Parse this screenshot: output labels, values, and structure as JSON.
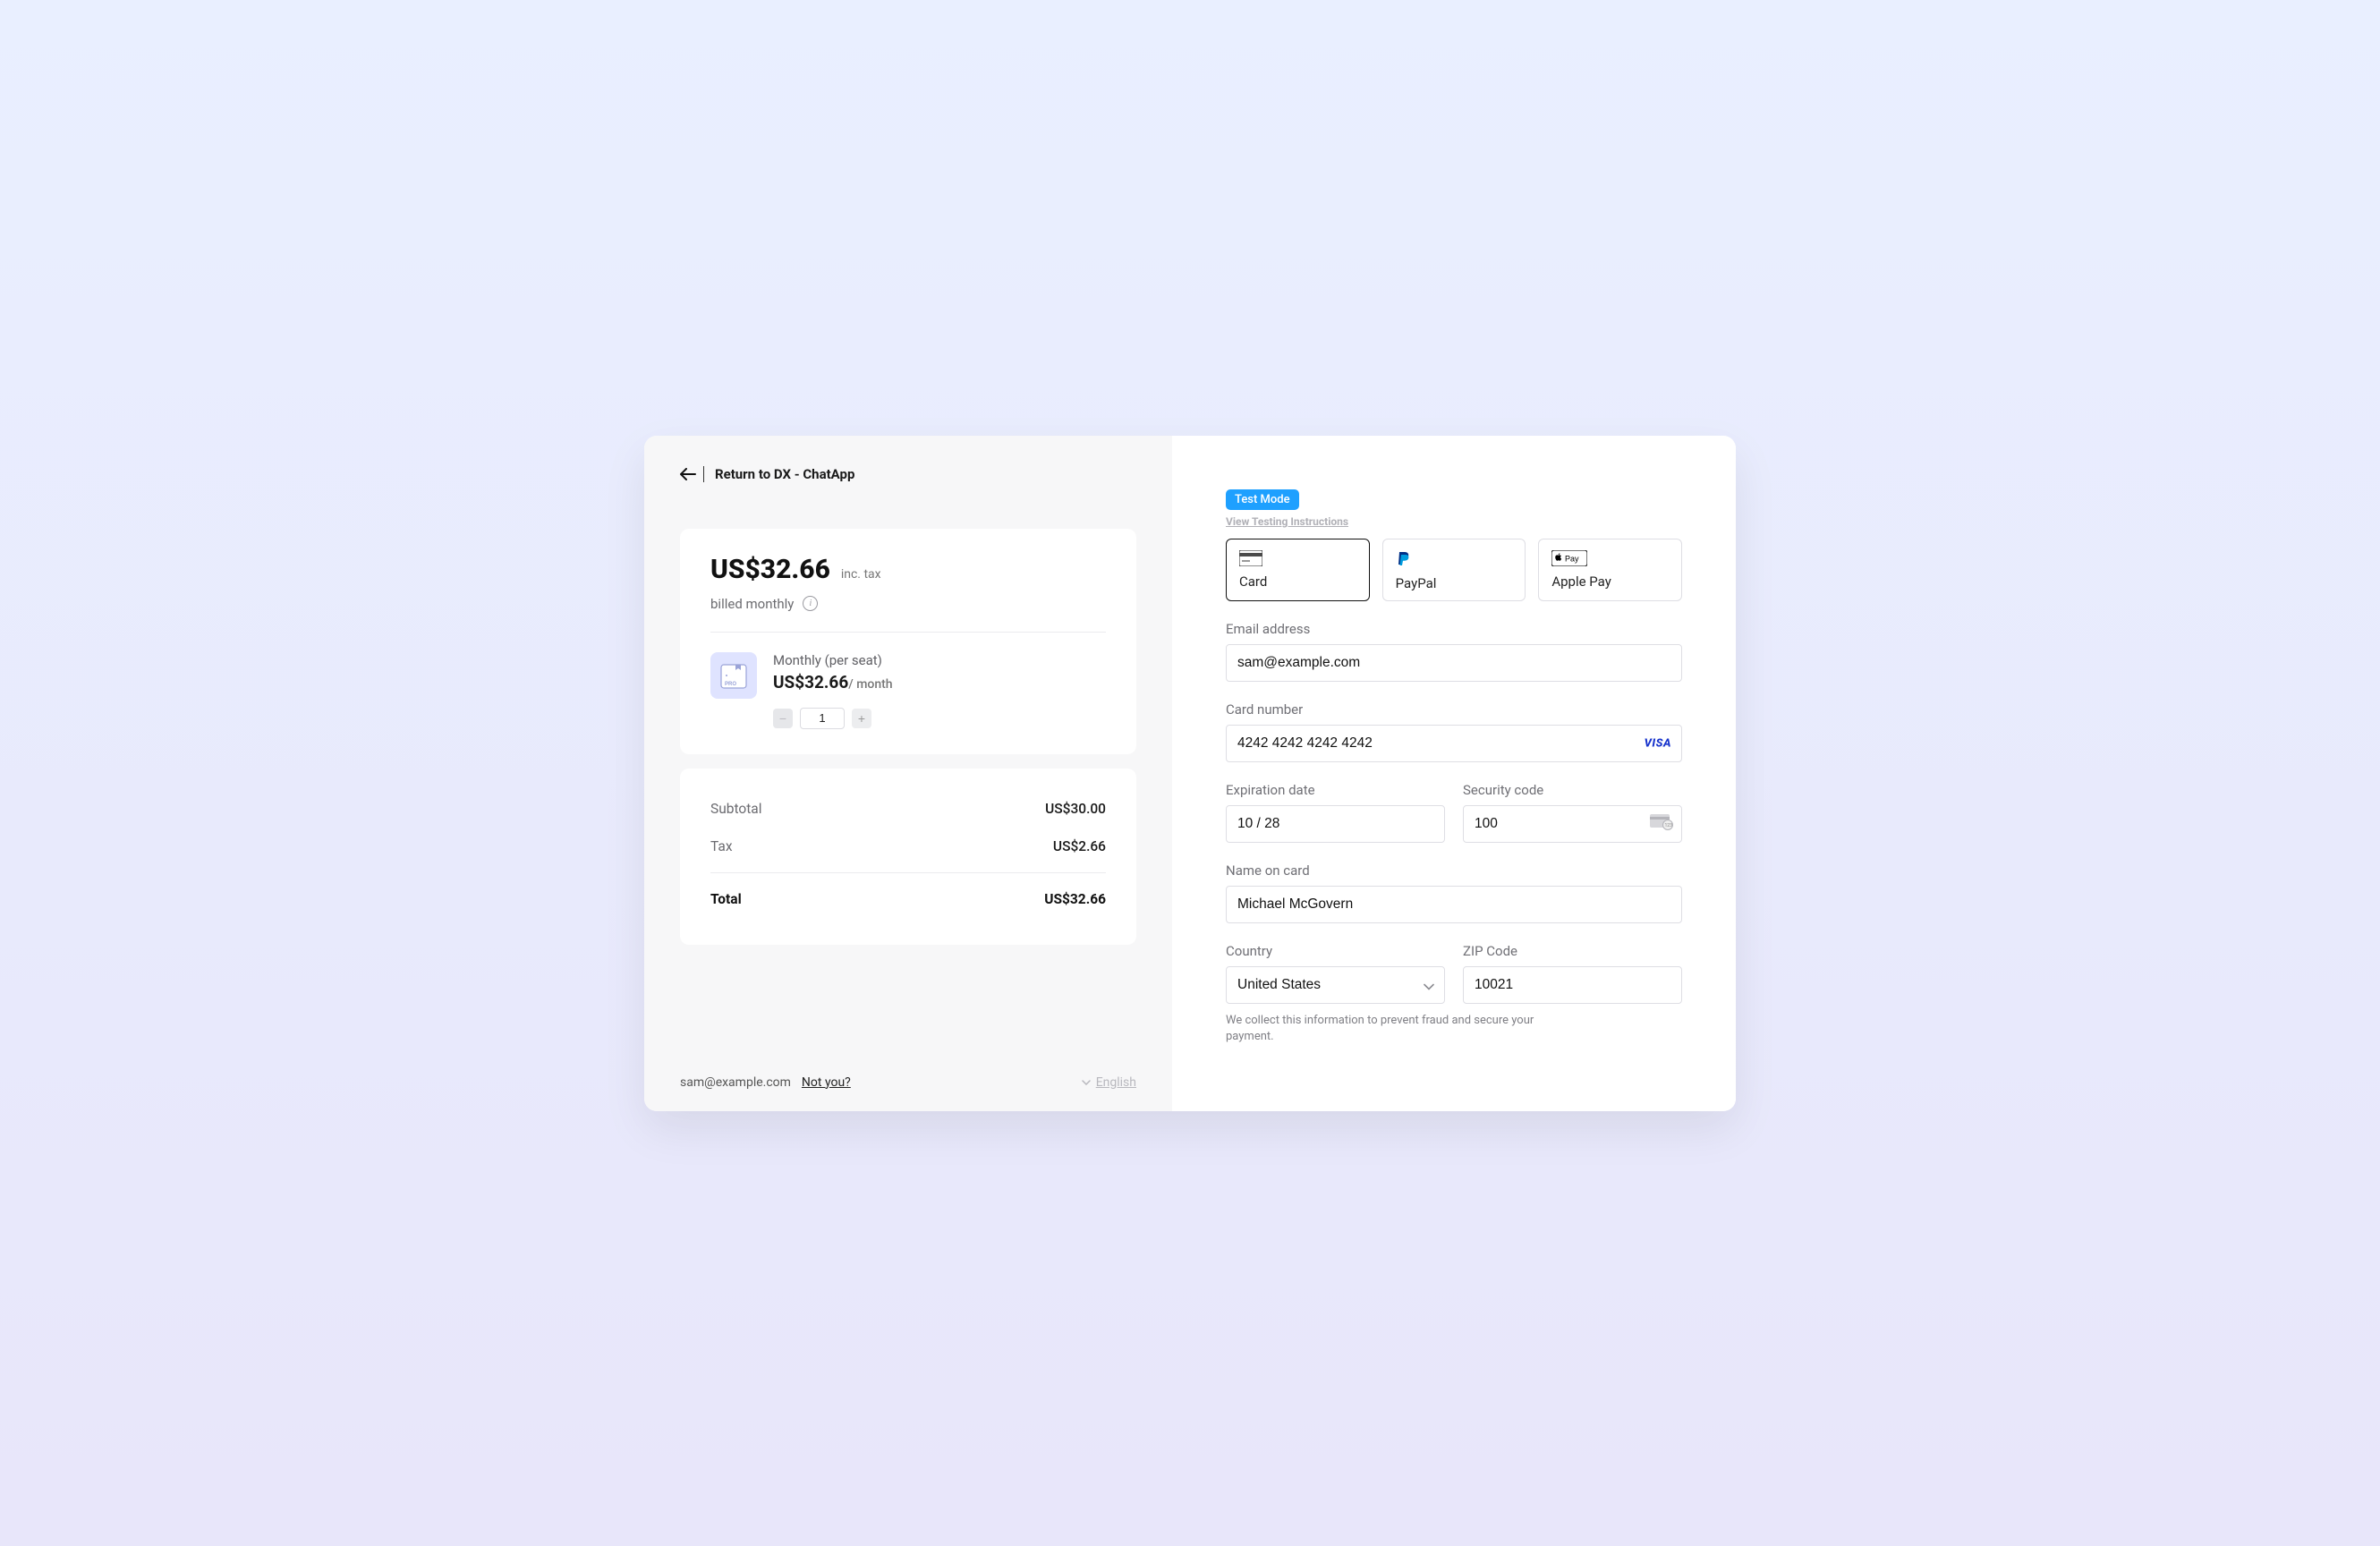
{
  "return_label": "Return to DX - ChatApp",
  "summary": {
    "price": "US$32.66",
    "inc_tax": "inc. tax",
    "billed": "billed monthly",
    "plan_name": "Monthly (per seat)",
    "plan_price": "US$32.66",
    "per_month": "/ month",
    "quantity": "1"
  },
  "totals": {
    "subtotal_label": "Subtotal",
    "subtotal_value": "US$30.00",
    "tax_label": "Tax",
    "tax_value": "US$2.66",
    "total_label": "Total",
    "total_value": "US$32.66"
  },
  "footer": {
    "email": "sam@example.com",
    "not_you": "Not you?",
    "language": "English"
  },
  "form": {
    "test_mode": "Test Mode",
    "test_link": "View Testing Instructions",
    "methods": {
      "card": "Card",
      "paypal": "PayPal",
      "applepay": "Apple Pay"
    },
    "email_label": "Email address",
    "email_value": "sam@example.com",
    "cardnum_label": "Card number",
    "cardnum_value": "4242 4242 4242 4242",
    "card_brand": "VISA",
    "exp_label": "Expiration date",
    "exp_value": "10 / 28",
    "cvc_label": "Security code",
    "cvc_value": "100",
    "name_label": "Name on card",
    "name_value": "Michael McGovern",
    "country_label": "Country",
    "country_value": "United States",
    "zip_label": "ZIP Code",
    "zip_value": "10021",
    "disclaimer": "We collect this information to prevent fraud and secure your payment."
  }
}
